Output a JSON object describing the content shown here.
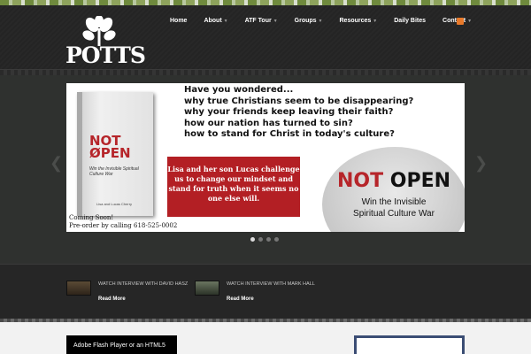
{
  "header": {
    "logo_text": "POTTS",
    "nav": [
      "Home",
      "About",
      "ATF Tour",
      "Groups",
      "Resources",
      "Daily Bites",
      "Contact"
    ],
    "nav_has_caret": [
      false,
      true,
      true,
      true,
      true,
      false,
      true
    ]
  },
  "slide": {
    "questions": [
      "Have you wondered...",
      "why true Christians seem to be disappearing?",
      "why your friends keep leaving their faith?",
      "how our nation has turned to sin?",
      "how to stand for Christ in today's culture?"
    ],
    "book_title_line1": "NOT",
    "book_title_line2": "ØPEN",
    "book_subtitle": "Win the Invisible Spiritual Culture War",
    "book_authors": "Lisa and Lucas Cherry",
    "coming_soon": "Coming Soon!",
    "preorder": "Pre-order by calling 618-525-0002",
    "red_box": "Lisa and her son Lucas challenge us to change our mindset and stand for truth when it seems no one else will.",
    "circle_not": "NOT",
    "circle_open": "OPEN",
    "circle_sub_line1": "Win the Invisible",
    "circle_sub_line2": "Spiritual Culture War"
  },
  "slider": {
    "dot_count": 4,
    "active_dot": 0
  },
  "videos": [
    {
      "title": "Watch interview with David Hasz",
      "more": "Read More"
    },
    {
      "title": "Watch interview with Mark Hall",
      "more": "Read More"
    }
  ],
  "content": {
    "flash_text": "Adobe Flash Player or an HTML5"
  },
  "colors": {
    "accent_green": "#6f8a3d",
    "red": "#b31f24",
    "rss": "#e8792a"
  }
}
